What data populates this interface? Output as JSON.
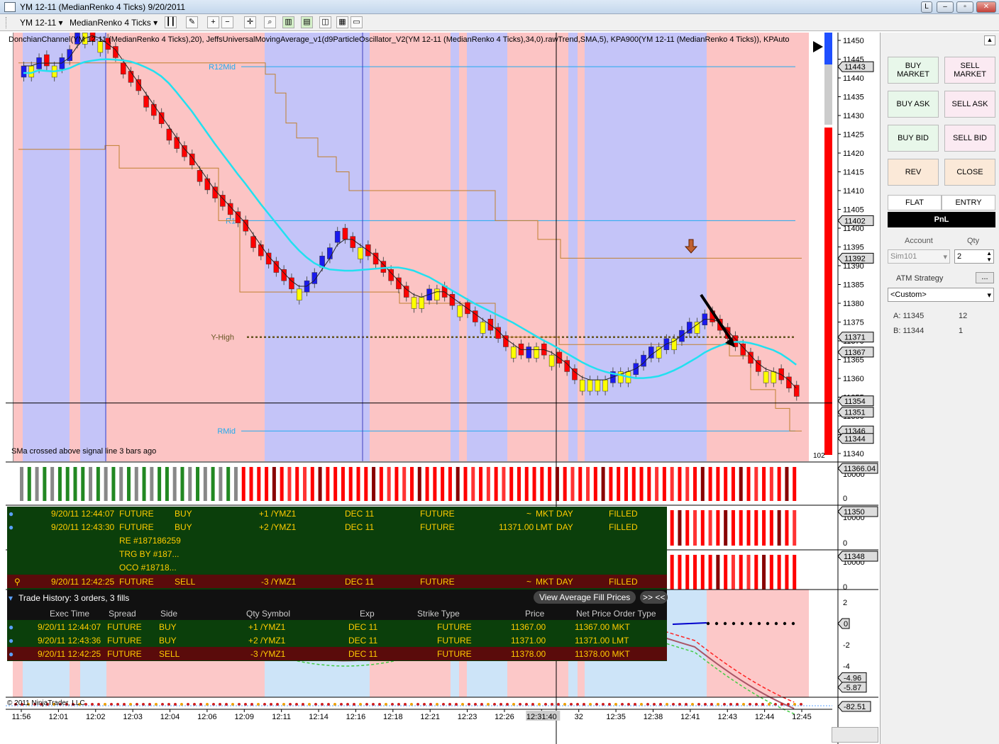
{
  "window": {
    "title": "YM 12-11 (MedianRenko 4 Ticks)  9/20/2011",
    "controls": [
      "L",
      "–",
      "▫",
      "✕"
    ]
  },
  "toolbar": {
    "instrument": "YM 12-11",
    "bartype": "MedianRenko 4 Ticks"
  },
  "chart": {
    "indicator_line": "DonchianChannel(YM 12-11 (MedianRenko 4 Ticks),20), JeffsUniversalMovingAverage_v1(d9ParticleOscillator_V2(YM 12-11 (MedianRenko 4 Ticks),34,0).rawTrend,SMA,5), KPA900(YM 12-11 (MedianRenko 4 Ticks)), KPAuto",
    "level_labels": {
      "r12mid": "R12Mid",
      "r1": "R1",
      "yhigh": "Y-High",
      "rmid": "RMid"
    },
    "crossed_text": "SMa crossed above signal line 3 bars ago",
    "bar_count": "102",
    "copyright": "© 2011 NinjaTrader, LLC",
    "price_axis": [
      "11450",
      "11445",
      "11440",
      "11435",
      "11430",
      "11425",
      "11420",
      "11415",
      "11410",
      "11405",
      "11400",
      "11395",
      "11390",
      "11385",
      "11380",
      "11375",
      "11370",
      "11365",
      "11360",
      "11355",
      "11350",
      "11345",
      "11340"
    ],
    "price_tags": [
      "11443",
      "11402",
      "11392",
      "11371",
      "11367",
      "11354",
      "11351",
      "11346",
      "11344"
    ],
    "time_axis": [
      "11:56",
      "12:01",
      "12:02",
      "12:03",
      "12:04",
      "12:06",
      "12:09",
      "12:11",
      "12:14",
      "12:16",
      "12:18",
      "12:21",
      "12:23",
      "12:26",
      "12:31:40",
      "32",
      "12:35",
      "12:38",
      "12:41",
      "12:43",
      "12:44",
      "12:45"
    ],
    "sub1": {
      "tag": "11366.04",
      "ticks": [
        "10000",
        "0"
      ]
    },
    "sub2": {
      "tag": "11350",
      "ticks": [
        "10000",
        "0"
      ]
    },
    "sub3": {
      "tag": "11348",
      "ticks": [
        "10000",
        "0"
      ]
    },
    "osc": {
      "ticks": [
        "2",
        "0",
        "-2",
        "-4"
      ],
      "tags": [
        "-4.96",
        "-5.87"
      ]
    },
    "bottom_tag": "-82.51"
  },
  "orders": {
    "rows": [
      {
        "time": "9/20/11 12:44:07",
        "type": "FUTURE",
        "side": "BUY",
        "qty": "+1 /YMZ1",
        "exp": "DEC 11",
        "strike_type": "FUTURE",
        "price": "~",
        "otype": "MKT",
        "tif": "DAY",
        "status": "FILLED"
      },
      {
        "time": "9/20/11 12:43:30",
        "type": "FUTURE",
        "side": "BUY",
        "qty": "+2 /YMZ1",
        "exp": "DEC 11",
        "strike_type": "FUTURE",
        "price": "11371.00",
        "otype": "LMT",
        "tif": "DAY",
        "status": "FILLED"
      },
      {
        "time": "RE #187186259"
      },
      {
        "time": "TRG BY #187..."
      },
      {
        "time": "OCO #18718..."
      },
      {
        "time": "9/20/11 12:42:25",
        "type": "FUTURE",
        "side": "SELL",
        "qty": "-3 /YMZ1",
        "exp": "DEC 11",
        "strike_type": "FUTURE",
        "price": "~",
        "otype": "MKT",
        "tif": "DAY",
        "status": "FILLED"
      }
    ],
    "history_title": "Trade History: 3 orders, 3 fills",
    "view_btn": "View Average Fill Prices",
    "toggle_btn": ">> <<",
    "headers": [
      "Exec Time",
      "Spread",
      "Side",
      "Qty  Symbol",
      "Exp",
      "Strike  Type",
      "Price",
      "Net Price  Order Type"
    ],
    "fills": [
      {
        "time": "9/20/11 12:44:07",
        "spread": "FUTURE",
        "side": "BUY",
        "qty": "+1 /YMZ1",
        "exp": "DEC 11",
        "type": "FUTURE",
        "price": "11367.00",
        "net": "11367.00 MKT"
      },
      {
        "time": "9/20/11 12:43:36",
        "spread": "FUTURE",
        "side": "BUY",
        "qty": "+2 /YMZ1",
        "exp": "DEC 11",
        "type": "FUTURE",
        "price": "11371.00",
        "net": "11371.00 LMT"
      },
      {
        "time": "9/20/11 12:42:25",
        "spread": "FUTURE",
        "side": "SELL",
        "qty": "-3 /YMZ1",
        "exp": "DEC 11",
        "type": "FUTURE",
        "price": "11378.00",
        "net": "11378.00 MKT"
      }
    ]
  },
  "panel": {
    "buy_market": "BUY MARKET",
    "sell_market": "SELL MARKET",
    "buy_ask": "BUY ASK",
    "sell_ask": "SELL ASK",
    "buy_bid": "BUY BID",
    "sell_bid": "SELL BID",
    "rev": "REV",
    "close": "CLOSE",
    "flat": "FLAT",
    "entry": "ENTRY",
    "pnl": "PnL",
    "account_label": "Account",
    "qty_label": "Qty",
    "account": "Sim101",
    "qty": "2",
    "atm_label": "ATM Strategy",
    "atm_btn": "...",
    "atm": "<Custom>",
    "a_label": "A:",
    "a_price": "11345",
    "a_qty": "12",
    "b_label": "B:",
    "b_price": "11344",
    "b_qty": "1"
  }
}
